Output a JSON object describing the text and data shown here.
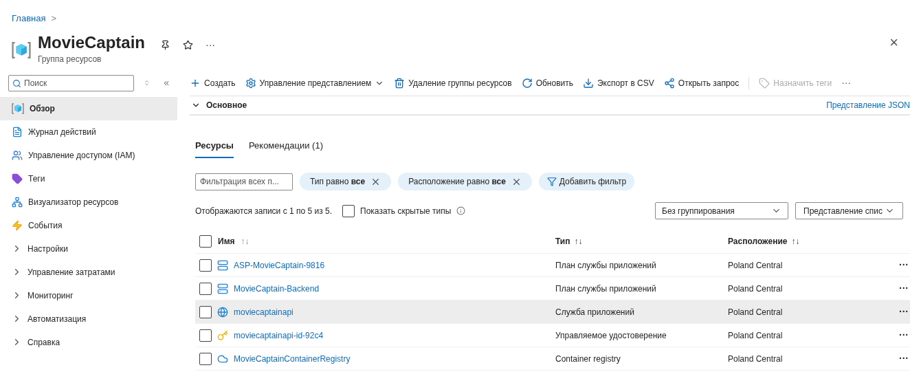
{
  "breadcrumb": {
    "items": [
      "Главная"
    ],
    "separator": ">"
  },
  "header": {
    "title": "MovieCaptain",
    "subtitle": "Группа ресурсов",
    "more": "···",
    "close": "×"
  },
  "sidebar": {
    "search": {
      "placeholder": "Поиск"
    },
    "collapse": "«",
    "items": [
      {
        "label": "Обзор",
        "kind": "page",
        "selected": true
      },
      {
        "label": "Журнал действий",
        "kind": "page",
        "selected": false
      },
      {
        "label": "Управление доступом (IAM)",
        "kind": "page",
        "selected": false
      },
      {
        "label": "Теги",
        "kind": "page",
        "selected": false
      },
      {
        "label": "Визуализатор ресурсов",
        "kind": "page",
        "selected": false
      },
      {
        "label": "События",
        "kind": "page",
        "selected": false
      },
      {
        "label": "Настройки",
        "kind": "group",
        "selected": false
      },
      {
        "label": "Управление затратами",
        "kind": "group",
        "selected": false
      },
      {
        "label": "Мониторинг",
        "kind": "group",
        "selected": false
      },
      {
        "label": "Автоматизация",
        "kind": "group",
        "selected": false
      },
      {
        "label": "Справка",
        "kind": "group",
        "selected": false
      }
    ]
  },
  "toolbar": {
    "items": [
      {
        "label": "Создать",
        "disabled": false,
        "dropdown": false
      },
      {
        "label": "Управление представлением",
        "disabled": false,
        "dropdown": true
      },
      {
        "label": "Удаление группы ресурсов",
        "disabled": false,
        "dropdown": false
      },
      {
        "label": "Обновить",
        "disabled": false,
        "dropdown": false
      },
      {
        "label": "Экспорт в CSV",
        "disabled": false,
        "dropdown": false
      },
      {
        "label": "Открыть запрос",
        "disabled": false,
        "dropdown": false
      },
      {
        "label": "Назначить теги",
        "disabled": true,
        "dropdown": false
      }
    ],
    "more": "···"
  },
  "essentials": {
    "label": "Основное",
    "expanded": true,
    "json_link": "Представление JSON"
  },
  "tabs": [
    {
      "label": "Ресурсы",
      "selected": true
    },
    {
      "label": "Рекомендации (1)",
      "selected": false
    }
  ],
  "filters": {
    "placeholder": "Фильтрация всех п...",
    "pills": [
      "Тип равно **все**",
      "Расположение равно **все**"
    ],
    "add": "Добавить фильтр"
  },
  "summary": "Отображаются записи с 1 по 5 из 5.",
  "show_hidden": {
    "label": "Показать скрытые типы",
    "checked": false
  },
  "grouping": "Без группирования",
  "view": "Представление спис",
  "table": {
    "select_all": {
      "checked": false
    },
    "columns": [
      "Имя",
      "Тип",
      "Расположение"
    ],
    "sort_mark": "↑↓",
    "rows": [
      {
        "name": "ASP-MovieCaptain-9816",
        "type": "План службы приложений",
        "location": "Poland Central",
        "checked": false,
        "hovered": false,
        "more": "···"
      },
      {
        "name": "MovieCaptain-Backend",
        "type": "План службы приложений",
        "location": "Poland Central",
        "checked": false,
        "hovered": false,
        "more": "···"
      },
      {
        "name": "moviecaptainapi",
        "type": "Служба приложений",
        "location": "Poland Central",
        "checked": false,
        "hovered": true,
        "more": "···"
      },
      {
        "name": "moviecaptainapi-id-92c4",
        "type": "Управляемое удостоверение",
        "location": "Poland Central",
        "checked": false,
        "hovered": false,
        "more": "···"
      },
      {
        "name": "MovieCaptainContainerRegistry",
        "type": "Container registry",
        "location": "Poland Central",
        "checked": false,
        "hovered": false,
        "more": "···"
      }
    ]
  }
}
